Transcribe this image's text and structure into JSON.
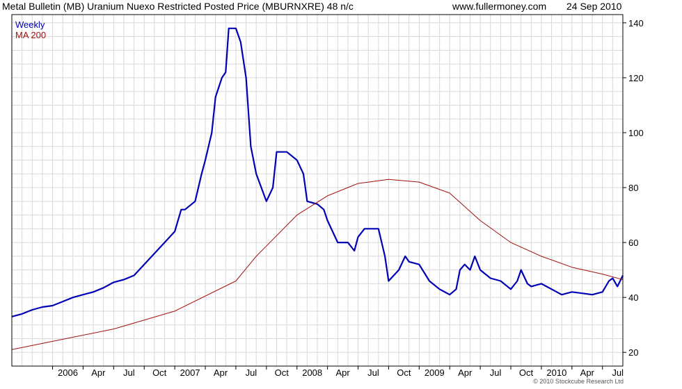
{
  "header": {
    "title": "Metal Bulletin (MB) Uranium Nuexo Restricted Posted Price (MBURNXRE) 48 n/c",
    "site": "www.fullermoney.com",
    "date": "24 Sep 2010"
  },
  "footer": {
    "credit": "© 2010 Stockcube Research Ltd"
  },
  "colors": {
    "weekly": "#0000b4",
    "ma200": "#a01010",
    "grid": "#d8d8d8"
  },
  "chart_data": {
    "type": "line",
    "title": "Metal Bulletin (MB) Uranium Nuexo Restricted Posted Price (MBURNXRE) 48 n/c",
    "x_tick_labels": [
      "2006",
      "Apr",
      "Jul",
      "Oct",
      "2007",
      "Apr",
      "Jul",
      "Oct",
      "2008",
      "Apr",
      "Jul",
      "Oct",
      "2009",
      "Apr",
      "Jul",
      "Oct",
      "2010",
      "Apr",
      "Jul"
    ],
    "x_tick_dates": [
      "2006-01",
      "2006-04",
      "2006-07",
      "2006-10",
      "2007-01",
      "2007-04",
      "2007-07",
      "2007-10",
      "2008-01",
      "2008-04",
      "2008-07",
      "2008-10",
      "2009-01",
      "2009-04",
      "2009-07",
      "2009-10",
      "2010-01",
      "2010-04",
      "2010-07"
    ],
    "y_ticks": [
      20,
      40,
      60,
      80,
      100,
      120,
      140
    ],
    "ylim": [
      15,
      143
    ],
    "xlim": [
      "2005-09",
      "2010-09"
    ],
    "grid": true,
    "legend_position": "top-left",
    "series": [
      {
        "name": "Weekly",
        "points": [
          [
            "2005-09",
            33
          ],
          [
            "2005-10",
            34
          ],
          [
            "2005-11",
            35.5
          ],
          [
            "2005-12",
            36.5
          ],
          [
            "2006-01",
            37
          ],
          [
            "2006-02",
            38.5
          ],
          [
            "2006-03",
            40
          ],
          [
            "2006-04",
            41
          ],
          [
            "2006-05",
            42
          ],
          [
            "2006-06",
            43.5
          ],
          [
            "2006-07",
            45.5
          ],
          [
            "2006-08",
            46.5
          ],
          [
            "2006-09",
            48
          ],
          [
            "2006-10",
            52
          ],
          [
            "2006-11",
            56
          ],
          [
            "2006-12",
            60
          ],
          [
            "2007-01",
            64
          ],
          [
            "2007-01-20",
            72
          ],
          [
            "2007-02",
            72
          ],
          [
            "2007-03",
            75
          ],
          [
            "2007-03-20",
            85
          ],
          [
            "2007-04",
            90
          ],
          [
            "2007-04-20",
            100
          ],
          [
            "2007-05",
            113
          ],
          [
            "2007-05-20",
            120
          ],
          [
            "2007-06",
            122
          ],
          [
            "2007-06-10",
            138
          ],
          [
            "2007-07",
            138
          ],
          [
            "2007-07-15",
            133
          ],
          [
            "2007-08",
            120
          ],
          [
            "2007-08-15",
            95
          ],
          [
            "2007-09",
            85
          ],
          [
            "2007-10",
            75
          ],
          [
            "2007-10-20",
            80
          ],
          [
            "2007-11",
            93
          ],
          [
            "2007-12",
            93
          ],
          [
            "2008-01",
            90
          ],
          [
            "2008-01-20",
            85
          ],
          [
            "2008-02",
            75
          ],
          [
            "2008-03",
            74
          ],
          [
            "2008-03-20",
            72
          ],
          [
            "2008-04",
            68
          ],
          [
            "2008-05",
            60
          ],
          [
            "2008-06",
            60
          ],
          [
            "2008-06-20",
            57
          ],
          [
            "2008-07",
            62
          ],
          [
            "2008-07-20",
            65
          ],
          [
            "2008-08",
            65
          ],
          [
            "2008-09",
            65
          ],
          [
            "2008-09-20",
            55
          ],
          [
            "2008-10",
            46
          ],
          [
            "2008-11",
            50
          ],
          [
            "2008-11-20",
            55
          ],
          [
            "2008-12",
            53
          ],
          [
            "2009-01",
            52
          ],
          [
            "2009-02",
            46
          ],
          [
            "2009-03",
            43
          ],
          [
            "2009-04",
            41
          ],
          [
            "2009-04-20",
            43
          ],
          [
            "2009-05",
            50
          ],
          [
            "2009-05-15",
            52
          ],
          [
            "2009-06",
            50
          ],
          [
            "2009-06-15",
            55
          ],
          [
            "2009-07",
            50
          ],
          [
            "2009-08",
            47
          ],
          [
            "2009-09",
            46
          ],
          [
            "2009-10",
            43
          ],
          [
            "2009-10-20",
            46
          ],
          [
            "2009-11",
            50
          ],
          [
            "2009-11-20",
            45
          ],
          [
            "2009-12",
            44
          ],
          [
            "2010-01",
            45
          ],
          [
            "2010-02",
            43
          ],
          [
            "2010-03",
            41
          ],
          [
            "2010-04",
            42
          ],
          [
            "2010-05",
            41.5
          ],
          [
            "2010-06",
            41
          ],
          [
            "2010-07",
            42
          ],
          [
            "2010-07-20",
            46
          ],
          [
            "2010-08",
            47
          ],
          [
            "2010-08-15",
            44
          ],
          [
            "2010-09",
            48
          ]
        ]
      },
      {
        "name": "MA 200",
        "points": [
          [
            "2005-09",
            21
          ],
          [
            "2006-01",
            24
          ],
          [
            "2006-07",
            28.5
          ],
          [
            "2007-01",
            35
          ],
          [
            "2007-07",
            46
          ],
          [
            "2007-09",
            55
          ],
          [
            "2008-01",
            70
          ],
          [
            "2008-04",
            77
          ],
          [
            "2008-07",
            81.5
          ],
          [
            "2008-10",
            83
          ],
          [
            "2009-01",
            82
          ],
          [
            "2009-04",
            78
          ],
          [
            "2009-07",
            68
          ],
          [
            "2009-10",
            60
          ],
          [
            "2010-01",
            55
          ],
          [
            "2010-04",
            51
          ],
          [
            "2010-07",
            48.5
          ],
          [
            "2010-09",
            46.5
          ]
        ]
      }
    ]
  }
}
